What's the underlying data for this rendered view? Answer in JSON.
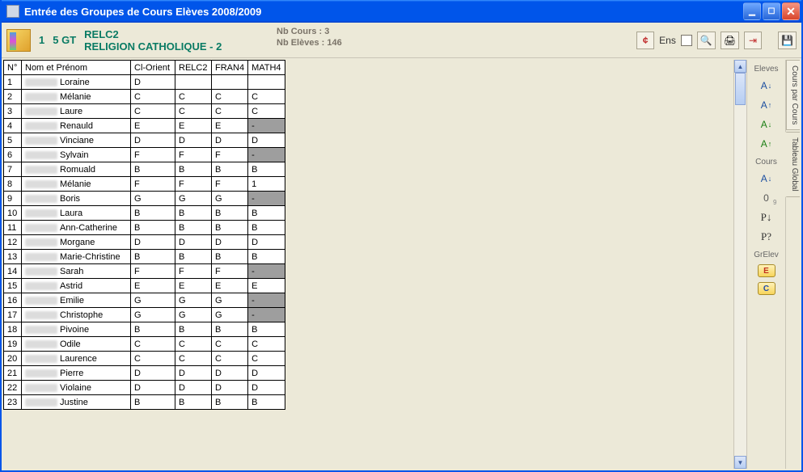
{
  "window": {
    "title": "Entrée des Groupes de Cours Elèves 2008/2009"
  },
  "header": {
    "pageNo": "1",
    "classCode": "5 GT",
    "courseCode": "RELC2",
    "courseName": "RELIGION CATHOLIQUE - 2",
    "nbCoursLabel": "Nb Cours :",
    "nbCoursValue": "3",
    "nbElevesLabel": "Nb Elèves :",
    "nbElevesValue": "146",
    "ensLabel": "Ens"
  },
  "table": {
    "headers": [
      "N°",
      "Nom et Prénom",
      "Cl-Orient",
      "RELC2",
      "FRAN4",
      "MATH4"
    ],
    "rows": [
      {
        "n": "1",
        "first": "Loraine",
        "clo": "D",
        "c1": "",
        "c2": "",
        "c3": ""
      },
      {
        "n": "2",
        "first": "Mélanie",
        "clo": "C",
        "c1": "C",
        "c2": "C",
        "c3": "C"
      },
      {
        "n": "3",
        "first": "Laure",
        "clo": "C",
        "c1": "C",
        "c2": "C",
        "c3": "C"
      },
      {
        "n": "4",
        "first": "Renauld",
        "clo": "E",
        "c1": "E",
        "c2": "E",
        "c3": "-",
        "gray3": true
      },
      {
        "n": "5",
        "first": "Vinciane",
        "clo": "D",
        "c1": "D",
        "c2": "D",
        "c3": "D"
      },
      {
        "n": "6",
        "first": "Sylvain",
        "clo": "F",
        "c1": "F",
        "c2": "F",
        "c3": "-",
        "gray3": true
      },
      {
        "n": "7",
        "first": "Romuald",
        "clo": "B",
        "c1": "B",
        "c2": "B",
        "c3": "B"
      },
      {
        "n": "8",
        "first": "Mélanie",
        "clo": "F",
        "c1": "F",
        "c2": "F",
        "c3": "1"
      },
      {
        "n": "9",
        "first": "Boris",
        "clo": "G",
        "c1": "G",
        "c2": "G",
        "c3": "-",
        "gray3": true
      },
      {
        "n": "10",
        "first": "Laura",
        "clo": "B",
        "c1": "B",
        "c2": "B",
        "c3": "B"
      },
      {
        "n": "11",
        "first": "Ann-Catherine",
        "clo": "B",
        "c1": "B",
        "c2": "B",
        "c3": "B"
      },
      {
        "n": "12",
        "first": "Morgane",
        "clo": "D",
        "c1": "D",
        "c2": "D",
        "c3": "D"
      },
      {
        "n": "13",
        "first": "Marie-Christine",
        "clo": "B",
        "c1": "B",
        "c2": "B",
        "c3": "B"
      },
      {
        "n": "14",
        "first": "Sarah",
        "clo": "F",
        "c1": "F",
        "c2": "F",
        "c3": "-",
        "gray3": true
      },
      {
        "n": "15",
        "first": "Astrid",
        "clo": "E",
        "c1": "E",
        "c2": "E",
        "c3": "E"
      },
      {
        "n": "16",
        "first": "Emilie",
        "clo": "G",
        "c1": "G",
        "c2": "G",
        "c3": "-",
        "gray3": true
      },
      {
        "n": "17",
        "first": "Christophe",
        "clo": "G",
        "c1": "G",
        "c2": "G",
        "c3": "-",
        "gray3": true
      },
      {
        "n": "18",
        "first": "Pivoine",
        "clo": "B",
        "c1": "B",
        "c2": "B",
        "c3": "B"
      },
      {
        "n": "19",
        "first": "Odile",
        "clo": "C",
        "c1": "C",
        "c2": "C",
        "c3": "C"
      },
      {
        "n": "20",
        "first": "Laurence",
        "clo": "C",
        "c1": "C",
        "c2": "C",
        "c3": "C"
      },
      {
        "n": "21",
        "first": "Pierre",
        "clo": "D",
        "c1": "D",
        "c2": "D",
        "c3": "D"
      },
      {
        "n": "22",
        "first": "Violaine",
        "clo": "D",
        "c1": "D",
        "c2": "D",
        "c3": "D"
      },
      {
        "n": "23",
        "first": "Justine",
        "clo": "B",
        "c1": "B",
        "c2": "B",
        "c3": "B"
      }
    ]
  },
  "rightPanel": {
    "elevesLabel": "Eleves",
    "coursLabel": "Cours",
    "grElevLabel": "GrElev",
    "sortAZ": "A↓Z",
    "p1": "P↓",
    "p2": "P?"
  },
  "sideTabs": {
    "tab1": "Cours par Cours",
    "tab2": "Tableau Global"
  }
}
